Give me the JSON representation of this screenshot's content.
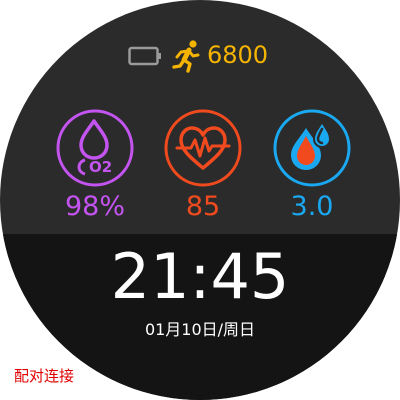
{
  "status": {
    "steps": "6800",
    "steps_icon": "running-person-icon",
    "battery_icon": "battery-low-icon"
  },
  "metrics": [
    {
      "id": "spo2",
      "icon": "blood-oxygen-icon",
      "icon_text": "O2",
      "value": "98%",
      "color": "#c454f0"
    },
    {
      "id": "heart",
      "icon": "heart-rate-icon",
      "value": "85",
      "color": "#f04a1e"
    },
    {
      "id": "sugar",
      "icon": "blood-drops-icon",
      "value": "3.0",
      "color": "#1aa9f0"
    }
  ],
  "time": "21:45",
  "date": "01月10日/周日",
  "pair_label": "配对连接",
  "colors": {
    "steps": "#f5b400",
    "battery": "#9a9a9a",
    "pair_label": "#e00000",
    "face_upper": "#2b2b2b",
    "face_lower": "#141414"
  }
}
